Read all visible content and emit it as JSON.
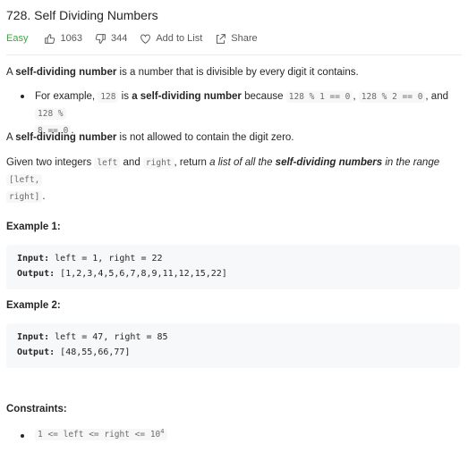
{
  "problem": {
    "title": "728. Self Dividing Numbers",
    "difficulty": "Easy",
    "likes": "1063",
    "dislikes": "344",
    "add_to_list": "Add to List",
    "share": "Share"
  },
  "description": {
    "p1_term": "self-dividing number",
    "p1_rest": " is a number that is divisible by every digit it contains.",
    "bullet_pre": "For example, ",
    "bullet_code1": "128",
    "bullet_mid": " is ",
    "bullet_bold": "a self-dividing number",
    "bullet_because": " because ",
    "bullet_code2": "128 % 1 == 0",
    "bullet_comma": ", ",
    "bullet_code3": "128 % 2 == 0",
    "bullet_and": ", and ",
    "bullet_code4": "128 %",
    "bullet_code5": "8 == 0",
    "bullet_end": ".",
    "p2_term": "self-dividing number",
    "p2_rest": " is not allowed to contain the digit zero.",
    "p3_pre": "Given two integers ",
    "p3_code1": "left",
    "p3_and": " and ",
    "p3_code2": "right",
    "p3_mid": ", return ",
    "p3_italic": "a list of all the ",
    "p3_bold": "self-dividing numbers",
    "p3_italic2": " in the range ",
    "p3_code3": "[left,",
    "p3_code4": "right]",
    "p3_end": "."
  },
  "examples": [
    {
      "title": "Example 1:",
      "input_label": "Input:",
      "input": " left = 1, right = 22",
      "output_label": "Output:",
      "output": " [1,2,3,4,5,6,7,8,9,11,12,15,22]"
    },
    {
      "title": "Example 2:",
      "input_label": "Input:",
      "input": " left = 47, right = 85",
      "output_label": "Output:",
      "output": " [48,55,66,77]"
    }
  ],
  "constraints": {
    "title": "Constraints:",
    "item_code": "1 <= left <= right <= 10",
    "item_exp": "4"
  },
  "colors": {
    "easy": "#43a047",
    "code_bg": "#f7f8fa"
  }
}
